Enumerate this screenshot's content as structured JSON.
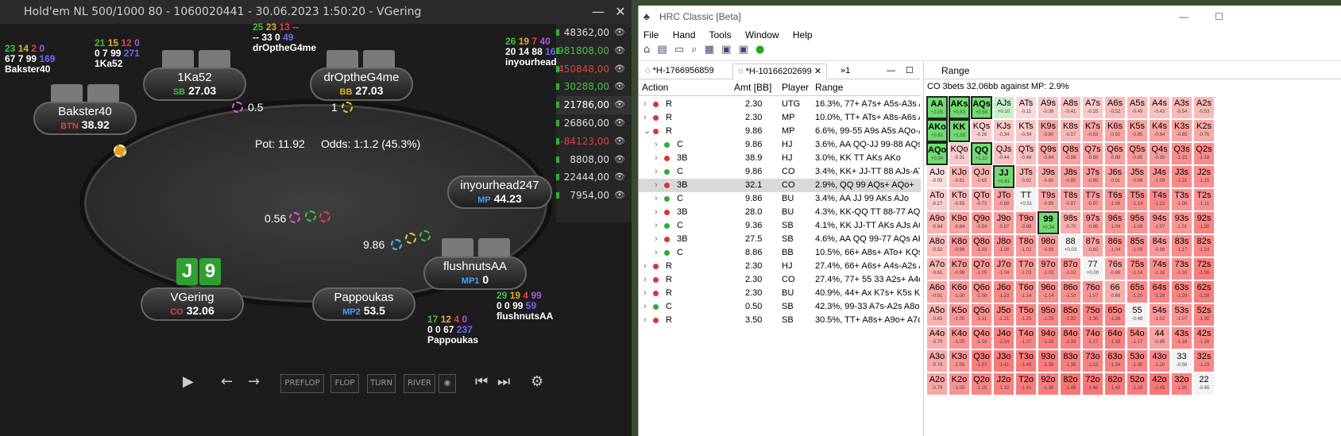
{
  "poker": {
    "title": "Hold'em NL 500/1000 80 - 1060020441 - 30.06.2023 1:50:20 - VGering",
    "pot": "Pot:  11.92",
    "odds": "Odds:  1:1.2 (45.3%)",
    "players": [
      {
        "name": "1Ka52",
        "pos": "SB",
        "stack": "27.03",
        "poscolor": "#3ec13e"
      },
      {
        "name": "drOptheG4me",
        "pos": "BB",
        "stack": "27.03",
        "poscolor": "#e0b030"
      },
      {
        "name": "Bakster40",
        "pos": "BTN",
        "stack": "38.92",
        "poscolor": "#e04040"
      },
      {
        "name": "inyourhead247",
        "pos": "MP",
        "stack": "44.23",
        "poscolor": "#3fa0ff"
      },
      {
        "name": "flushnutsAA",
        "pos": "MP1",
        "stack": "0",
        "poscolor": "#3fa0ff"
      },
      {
        "name": "Pappoukas",
        "pos": "MP2",
        "stack": "53.5",
        "poscolor": "#3fa0ff"
      },
      {
        "name": "VGering",
        "pos": "CO",
        "stack": "32.06",
        "poscolor": "#e04040"
      }
    ],
    "stats": {
      "bakster": {
        "a": "23",
        "b": "14",
        "c": "2",
        "d": "0",
        "e": "67",
        "f": "7",
        "g": "99",
        "h": "169",
        "name": "Bakster40"
      },
      "ka52": {
        "a": "21",
        "b": "15",
        "c": "12",
        "d": "0",
        "e": "0",
        "f": "7",
        "g": "99",
        "h": "271",
        "name": "1Ka52"
      },
      "drop": {
        "a": "25",
        "b": "23",
        "c": "13",
        "d": "--",
        "e": "--",
        "f": "33",
        "g": "0",
        "h": "49",
        "name": "drOptheG4me"
      },
      "inyour": {
        "a": "26",
        "b": "19",
        "c": "7",
        "d": "40",
        "e": "20",
        "f": "14",
        "g": "88",
        "h": "163",
        "name": "inyourhead247"
      },
      "flush": {
        "a": "29",
        "b": "19",
        "c": "4",
        "d": "99",
        "e": "0",
        "f": "0",
        "g": "99",
        "h": "59",
        "name": "flushnutsAA"
      },
      "papp": {
        "a": "17",
        "b": "12",
        "c": "4",
        "d": "0",
        "e": "0",
        "f": "0",
        "g": "67",
        "h": "237",
        "name": "Pappoukas"
      }
    },
    "bets": {
      "sb": "0.5",
      "bb": "1",
      "center": "0.56",
      "mp": "9.86"
    },
    "hero_cards": [
      "J",
      "9"
    ],
    "side_values": [
      "48362,00",
      "981808,00",
      "450848,00",
      "30288,00",
      "21786,00",
      "26860,00",
      "-84123,00",
      "8808,00",
      "22444,00",
      "7954,00"
    ],
    "side_colors": [
      "#ddd",
      "#3ec13e",
      "#e04040",
      "#3ec13e",
      "#fff",
      "#ddd",
      "#e04040",
      "#ddd",
      "#ddd",
      "#ddd"
    ],
    "controls": [
      "PREFLOP",
      "FLOP",
      "TURN",
      "RIVER"
    ]
  },
  "hrc": {
    "title": "HRC Classic [Beta]",
    "menu": [
      "File",
      "Hand",
      "Tools",
      "Window",
      "Help"
    ],
    "tab1": "*H-1766956859",
    "tab2": "*H-10166202699",
    "tab3": "»1",
    "headers": {
      "action": "Action",
      "amt": "Amt [BB]",
      "player": "Player",
      "range": "Range"
    },
    "rows": [
      {
        "ind": 0,
        "open": false,
        "dot": "#d33",
        "act": "R",
        "amt": "2.30",
        "pl": "UTG",
        "rng": "16.3%, 77+ A7s+ A5s-A3s A"
      },
      {
        "ind": 0,
        "open": false,
        "dot": "#d33",
        "act": "R",
        "amt": "2.30",
        "pl": "MP",
        "rng": "10.0%, TT+ ATs+ A8s-A6s A"
      },
      {
        "ind": 0,
        "open": true,
        "dot": "#d33",
        "act": "R",
        "amt": "9.86",
        "pl": "MP",
        "rng": "6.6%, 99-55 A9s A5s AQo-A"
      },
      {
        "ind": 1,
        "open": false,
        "dot": "#3a3",
        "act": "C",
        "amt": "9.86",
        "pl": "HJ",
        "rng": "3.6%, AA QQ-JJ 99-88 AQs"
      },
      {
        "ind": 1,
        "open": false,
        "dot": "#d33",
        "act": "3B",
        "amt": "38.9",
        "pl": "HJ",
        "rng": "3.0%, KK TT AKs AKo"
      },
      {
        "ind": 1,
        "open": false,
        "dot": "#3a3",
        "act": "C",
        "amt": "9.86",
        "pl": "CO",
        "rng": "3.4%, KK+ JJ-TT 88 AJs-ATs"
      },
      {
        "ind": 1,
        "open": false,
        "dot": "#d33",
        "act": "3B",
        "amt": "32.1",
        "pl": "CO",
        "rng": "2.9%, QQ 99 AQs+ AQo+",
        "sel": true
      },
      {
        "ind": 1,
        "open": false,
        "dot": "#3a3",
        "act": "C",
        "amt": "9.86",
        "pl": "BU",
        "rng": "3.4%, AA JJ 99 AKs AJo"
      },
      {
        "ind": 1,
        "open": false,
        "dot": "#d33",
        "act": "3B",
        "amt": "28.0",
        "pl": "BU",
        "rng": "4.3%, KK-QQ TT 88-77 AQs"
      },
      {
        "ind": 1,
        "open": false,
        "dot": "#3a3",
        "act": "C",
        "amt": "9.36",
        "pl": "SB",
        "rng": "4.1%, KK JJ-TT AKs AJs AQo"
      },
      {
        "ind": 1,
        "open": false,
        "dot": "#d33",
        "act": "3B",
        "amt": "27.5",
        "pl": "SB",
        "rng": "4.6%, AA QQ 99-77 AQs AK"
      },
      {
        "ind": 1,
        "open": false,
        "dot": "#3a3",
        "act": "C",
        "amt": "8.86",
        "pl": "BB",
        "rng": "10.5%, 66+ A8s+ ATo+ KQs"
      },
      {
        "ind": 0,
        "open": false,
        "dot": "#d33",
        "act": "R",
        "amt": "2.30",
        "pl": "HJ",
        "rng": "27.4%, 66+ A6s+ A4s-A2s A"
      },
      {
        "ind": 0,
        "open": false,
        "dot": "#d33",
        "act": "R",
        "amt": "2.30",
        "pl": "CO",
        "rng": "27.4%, 77+ 55 33 A2s+ A4o"
      },
      {
        "ind": 0,
        "open": false,
        "dot": "#d33",
        "act": "R",
        "amt": "2.30",
        "pl": "BU",
        "rng": "40.9%, 44+ Ax K7s+ K5s K2"
      },
      {
        "ind": 0,
        "open": false,
        "dot": "#3a3",
        "act": "C",
        "amt": "0.50",
        "pl": "SB",
        "rng": "42.3%, 99-33 A7s-A2s A8o"
      },
      {
        "ind": 0,
        "open": false,
        "dot": "#d33",
        "act": "R",
        "amt": "3.50",
        "pl": "SB",
        "rng": "30.5%, TT+ A8s+ A9o+ A7o"
      }
    ],
    "range_title": "Range",
    "range_desc": "CO 3bets 32.06bb against MP: 2.9%",
    "ranks": [
      "A",
      "K",
      "Q",
      "J",
      "T",
      "9",
      "8",
      "7",
      "6",
      "5",
      "4",
      "3",
      "2"
    ],
    "ev": [
      [
        "+2.05",
        "+0.83",
        "+0.58",
        "+0.10",
        "-0.11",
        "-0.36",
        "-0.41",
        "-0.33",
        "-0.52",
        "-0.49",
        "-0.43",
        "-0.54",
        "-0.53"
      ],
      [
        "+0.61",
        "+1.55",
        "-0.26",
        "-0.34",
        "-0.34",
        "-0.80",
        "-0.57",
        "-0.83",
        "-0.82",
        "-0.85",
        "-0.84",
        "-0.85",
        "-0.76"
      ],
      [
        "+0.34",
        "-0.31",
        "+1.22",
        "-0.44",
        "-0.48",
        "-0.84",
        "-0.88",
        "-0.88",
        "-0.89",
        "-0.95",
        "-0.95",
        "-1.15",
        "-1.18"
      ],
      [
        "-0.05",
        "-0.61",
        "-0.65",
        "+0.81",
        "-0.62",
        "-0.80",
        "-0.95",
        "-0.95",
        "-0.91",
        "-0.98",
        "-1.09",
        "-1.21",
        "-1.15"
      ],
      [
        "-0.27",
        "-0.55",
        "-0.72",
        "-0.88",
        "+0.51",
        "-0.85",
        "-0.87",
        "-0.97",
        "-1.06",
        "-1.14",
        "-1.22",
        "-1.06",
        "-1.11"
      ],
      [
        "-0.64",
        "-0.84",
        "-0.94",
        "-0.97",
        "-0.98",
        "+0.34",
        "-0.70",
        "-0.95",
        "-1.04",
        "-1.08",
        "-1.07",
        "-1.01",
        "-1.30"
      ],
      [
        "-0.52",
        "-0.98",
        "-1.03",
        "-1.08",
        "-1.02",
        "-0.99",
        "+0.03",
        "-0.82",
        "-1.04",
        "-1.09",
        "-0.98",
        "-1.17",
        "-1.24"
      ],
      [
        "-0.61",
        "-0.98",
        "-1.05",
        "-1.04",
        "-1.03",
        "-1.03",
        "-1.02",
        "+0.00",
        "-0.86",
        "-1.14",
        "-1.16",
        "-1.16",
        "-1.36"
      ],
      [
        "-0.81",
        "-1.00",
        "-1.08",
        "-1.23",
        "-1.14",
        "-1.14",
        "-1.10",
        "-1.07",
        "-0.69",
        "-1.20",
        "-1.28",
        "-1.29",
        "-1.38"
      ],
      [
        "-0.63",
        "-1.00",
        "-1.11",
        "-1.21",
        "-1.25",
        "-1.25",
        "-1.32",
        "-1.30",
        "-1.28",
        "-0.48",
        "-1.02",
        "-1.07",
        "-1.30"
      ],
      [
        "-0.70",
        "-1.05",
        "-1.18",
        "-1.34",
        "-1.27",
        "-1.33",
        "-1.33",
        "-1.27",
        "-1.33",
        "-1.17",
        "-0.86",
        "-1.18",
        "-1.26"
      ],
      [
        "-0.76",
        "-1.05",
        "-1.37",
        "-1.41",
        "-1.40",
        "-1.38",
        "-1.35",
        "-1.31",
        "-1.34",
        "-1.30",
        "-1.20",
        "-0.56",
        "-1.23"
      ],
      [
        "-0.79",
        "-1.05",
        "-1.25",
        "-1.32",
        "-1.41",
        "-1.38",
        "-1.48",
        "-1.46",
        "-1.40",
        "-1.38",
        "-1.45",
        "-1.30",
        "-0.45"
      ]
    ],
    "selected": [
      "AA",
      "AKs",
      "AQs",
      "AKo",
      "KK",
      "AQo",
      "QQ",
      "JJ",
      "99"
    ]
  }
}
